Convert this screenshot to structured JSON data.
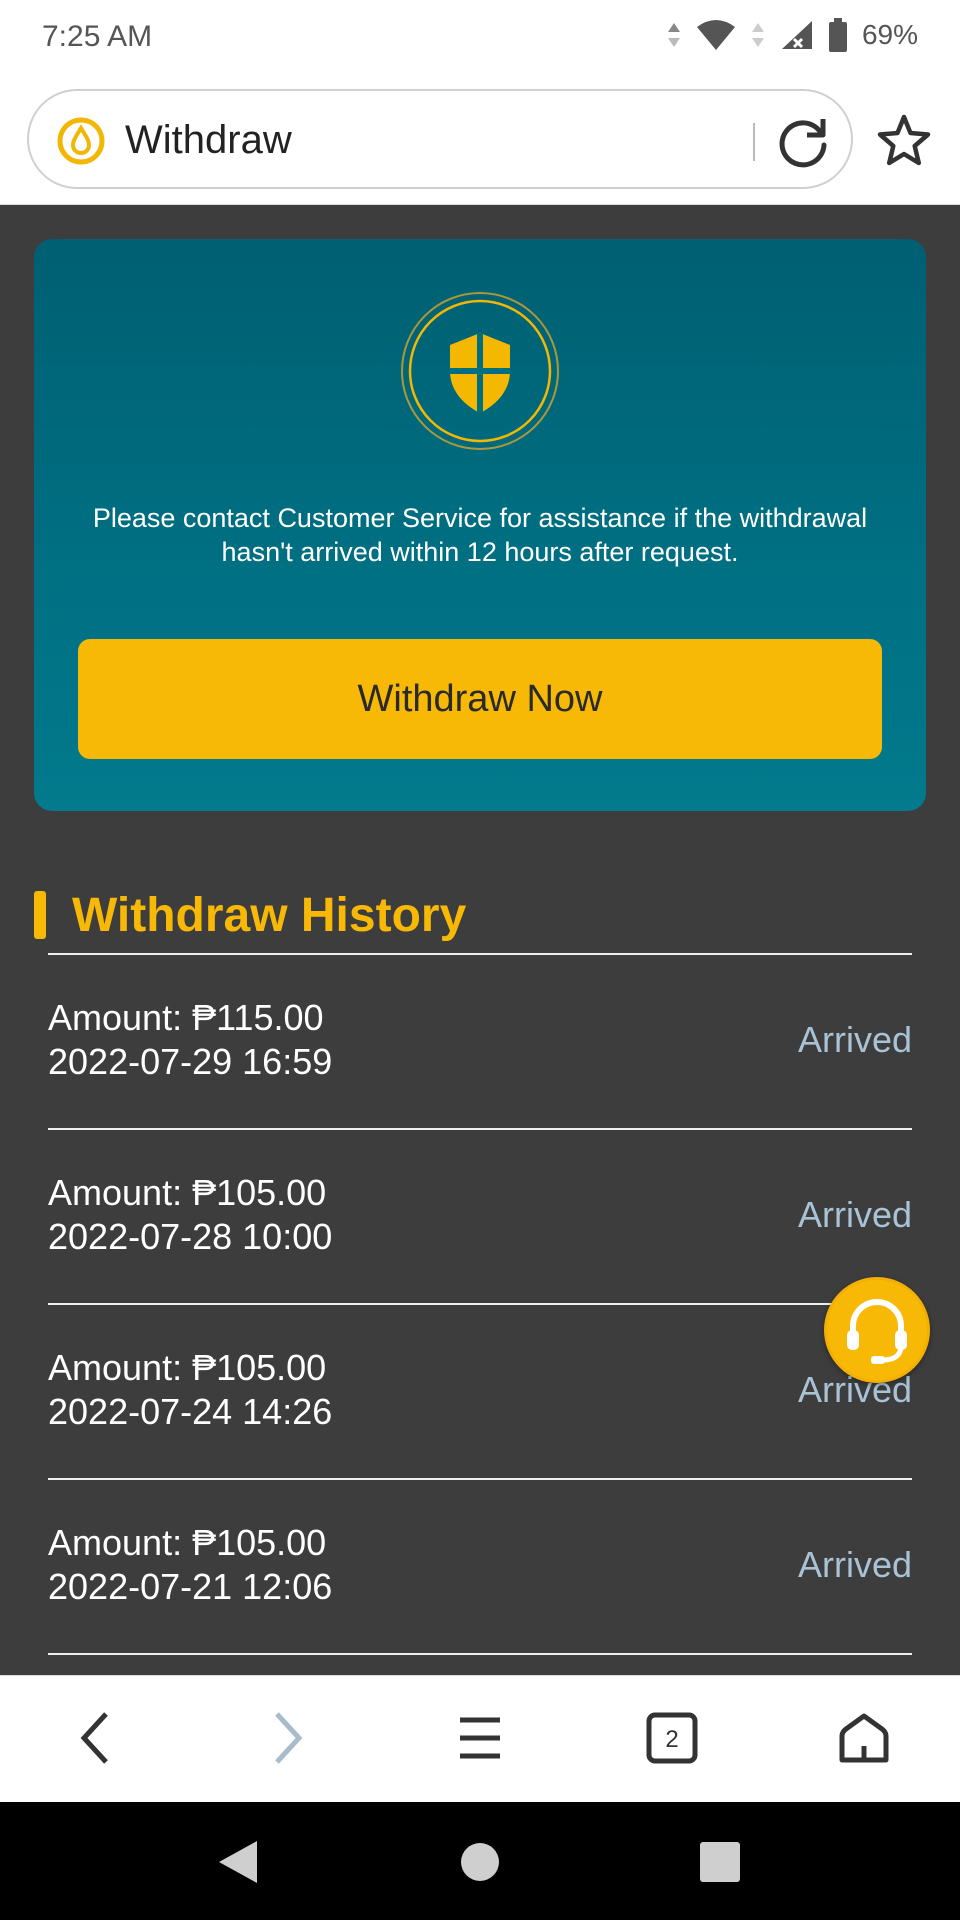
{
  "status_bar": {
    "time": "7:25 AM",
    "battery": "69%"
  },
  "browser": {
    "page_title": "Withdraw",
    "tab_count": "2"
  },
  "hero": {
    "notice": "Please contact Customer Service for assistance if the withdrawal hasn't arrived within 12 hours after request.",
    "button_label": "Withdraw Now"
  },
  "history": {
    "title": "Withdraw History",
    "rows": [
      {
        "amount": "Amount: ₱115.00",
        "date": "2022-07-29 16:59",
        "status": "Arrived"
      },
      {
        "amount": "Amount: ₱105.00",
        "date": "2022-07-28 10:00",
        "status": "Arrived"
      },
      {
        "amount": "Amount: ₱105.00",
        "date": "2022-07-24 14:26",
        "status": "Arrived"
      },
      {
        "amount": "Amount: ₱105.00",
        "date": "2022-07-21 12:06",
        "status": "Arrived"
      }
    ]
  },
  "colors": {
    "accent": "#f8b906",
    "hero": "#006f82",
    "background": "#3d3d3d",
    "status_text": "#a9c3d6"
  },
  "icons": {
    "site": "site-drop-icon",
    "reload": "reload-icon",
    "bookmark": "star-icon",
    "shield": "shield-icon",
    "support": "headset-icon",
    "back": "chevron-left-icon",
    "forward": "chevron-right-icon",
    "menu": "hamburger-icon",
    "tabs": "tabs-icon",
    "home": "home-icon"
  }
}
